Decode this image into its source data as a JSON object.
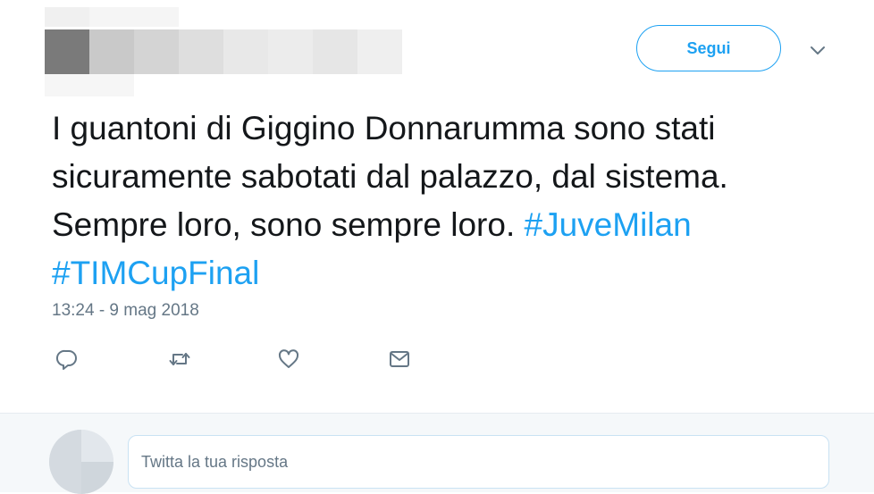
{
  "header": {
    "follow_label": "Segui",
    "caret_icon": "chevron-down-icon"
  },
  "tweet": {
    "lines": [
      [
        {
          "text": "I guantoni di Giggino Donnarumma sono stati",
          "hashtag": false
        }
      ],
      [
        {
          "text": "sicuramente sabotati dal palazzo, dal sistema.",
          "hashtag": false
        }
      ],
      [
        {
          "text": "Sempre loro, sono sempre loro. ",
          "hashtag": false
        },
        {
          "text": "#JuveMilan",
          "hashtag": true
        }
      ],
      [
        {
          "text": "#TIMCupFinal",
          "hashtag": true
        }
      ]
    ],
    "timestamp": "13:24 - 9 mag 2018"
  },
  "actions": [
    {
      "name": "reply-icon"
    },
    {
      "name": "retweet-icon"
    },
    {
      "name": "like-icon"
    },
    {
      "name": "direct-message-icon"
    }
  ],
  "reply": {
    "placeholder": "Twitta la tua risposta"
  },
  "colors": {
    "accent": "#1da1f2",
    "text": "#14171a",
    "muted": "#657786",
    "reply_background": "#f5f8fa"
  }
}
